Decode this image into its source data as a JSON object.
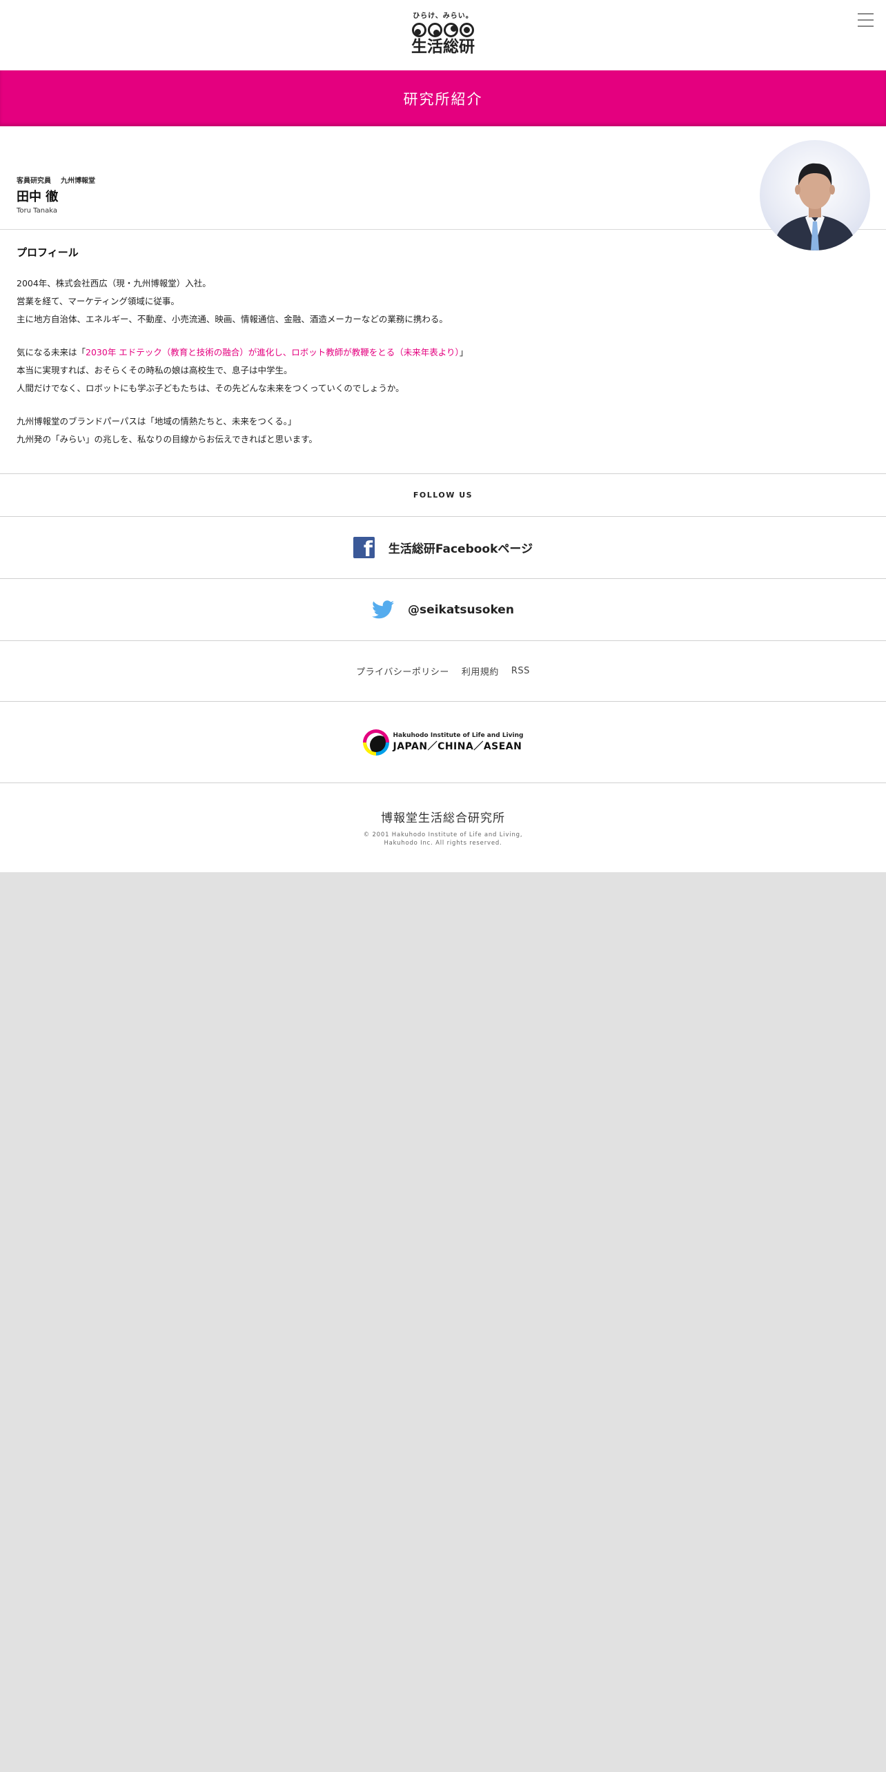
{
  "header": {
    "logo_tagline": "ひらけ、みらい。",
    "logo_text": "生活総研"
  },
  "banner": {
    "title": "研究所紹介"
  },
  "profile": {
    "role": "客員研究員",
    "affiliation": "九州博報堂",
    "name_jp": "田中 徹",
    "name_en": "Toru Tanaka",
    "section_title": "プロフィール",
    "para1": [
      "2004年、株式会社西広（現・九州博報堂）入社。",
      "営業を経て、マーケティング領域に従事。",
      "主に地方自治体、エネルギー、不動産、小売流通、映画、情報通信、金融、酒造メーカーなどの業務に携わる。"
    ],
    "para2_prefix": "気になる未来は「",
    "para2_link": "2030年 エドテック（教育と技術の融合）が進化し、ロボット教師が教鞭をとる（未来年表より）",
    "para2_suffix": "」",
    "para2_rest": [
      "本当に実現すれば、おそらくその時私の娘は高校生で、息子は中学生。",
      "人間だけでなく、ロボットにも学ぶ子どもたちは、その先どんな未来をつくっていくのでしょうか。"
    ],
    "para3": [
      "九州博報堂のブランドパーパスは「地域の情熱たちと、未来をつくる。」",
      "九州発の「みらい」の兆しを、私なりの目線からお伝えできればと思います。"
    ]
  },
  "footer": {
    "follow_label": "FOLLOW US",
    "facebook_label": "生活総研Facebookページ",
    "twitter_label": "@seikatsusoken",
    "links": [
      "プライバシーポリシー",
      "利用規約",
      "RSS"
    ],
    "brand_sub": "Hakuhodo Institute of Life and Living",
    "brand_main": "JAPAN／CHINA／ASEAN",
    "org_name": "博報堂生活総合研究所",
    "copyright_1": "© 2001 Hakuhodo Institute of Life and Living,",
    "copyright_2": "Hakuhodo Inc. All rights reserved."
  },
  "colors": {
    "accent": "#e4007f",
    "facebook": "#3b5998",
    "twitter": "#55acee",
    "background": "#e1e1e1"
  }
}
